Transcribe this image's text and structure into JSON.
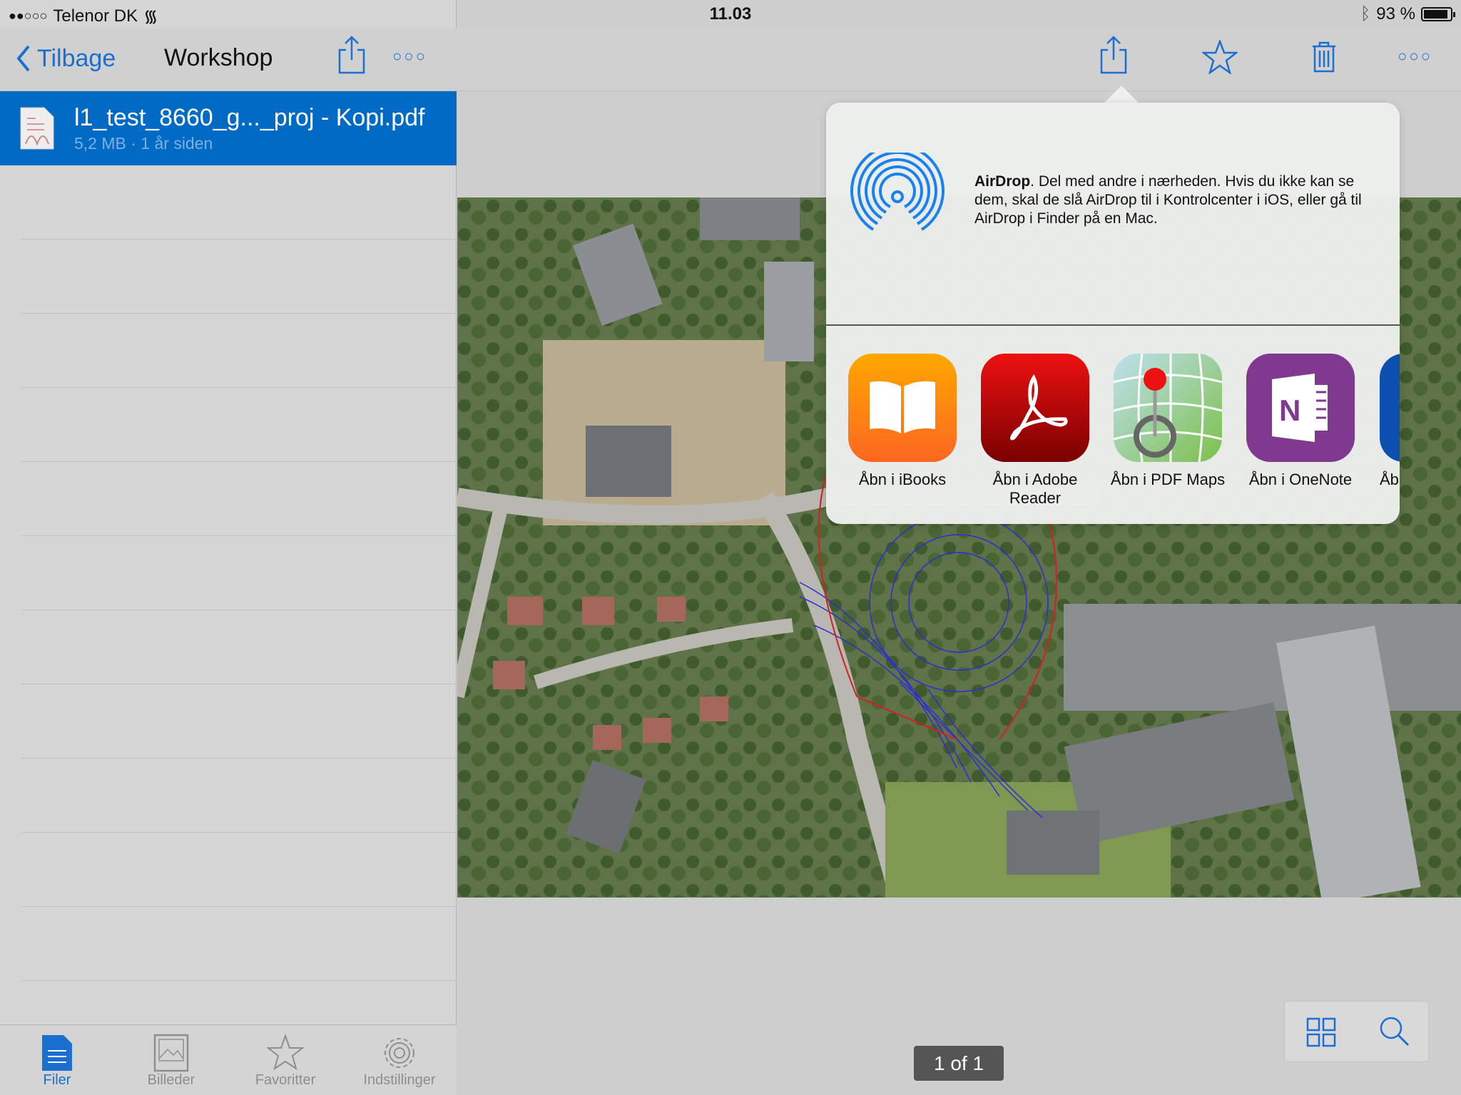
{
  "status_bar": {
    "carrier": "Telenor DK",
    "time": "11.03",
    "battery": "93 %",
    "battery_level": 0.93
  },
  "sidebar": {
    "back_label": "Tilbage",
    "title": "Workshop",
    "selected_file": {
      "name": "l1_test_8660_g..._proj - Kopi.pdf",
      "meta": "5,2 MB · 1 år siden"
    },
    "tabs": [
      {
        "label": "Filer",
        "icon": "document-icon",
        "active": true
      },
      {
        "label": "Billeder",
        "icon": "image-icon"
      },
      {
        "label": "Favoritter",
        "icon": "star-icon"
      },
      {
        "label": "Indstillinger",
        "icon": "gear-icon"
      }
    ]
  },
  "toolbar": {
    "icons": [
      "share-icon",
      "star-icon",
      "trash-icon",
      "more-icon"
    ]
  },
  "share_sheet": {
    "airdrop_title": "AirDrop",
    "airdrop_text": ". Del med andre i nærheden. Hvis du ikke kan se dem, skal de slå AirDrop til i Kontrolcenter i iOS, eller gå til AirDrop i Finder på en Mac.",
    "apps": [
      {
        "label": "Åbn i iBooks"
      },
      {
        "label": "Åbn i Adobe Reader"
      },
      {
        "label": "Åbn i PDF Maps"
      },
      {
        "label": "Åbn i OneNote"
      },
      {
        "label": "Åb"
      }
    ]
  },
  "page_indicator": "1 of 1",
  "colors": {
    "accent": "#1a6fd0",
    "selection": "#006ac4"
  }
}
